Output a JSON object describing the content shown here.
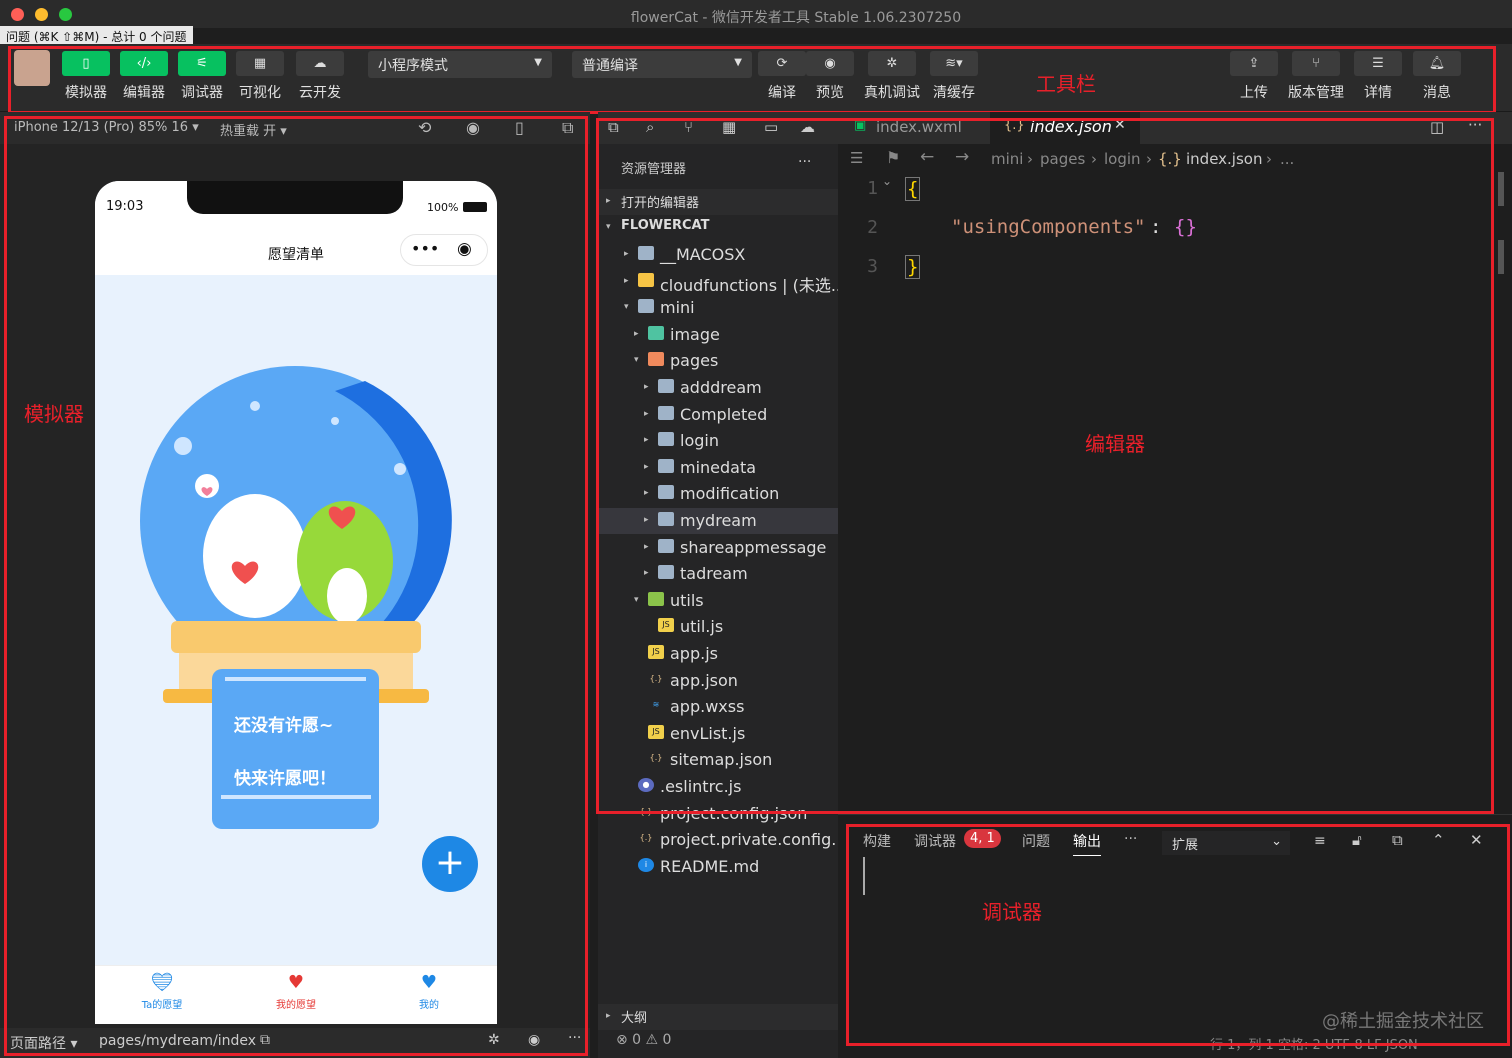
{
  "window": {
    "title": "flowerCat - 微信开发者工具 Stable 1.06.2307250",
    "issues": "问题 (⌘K ⇧⌘M) - 总计 0 个问题"
  },
  "toolbar": {
    "simulator": "模拟器",
    "editor": "编辑器",
    "debugger": "调试器",
    "visual": "可视化",
    "cloud": "云开发",
    "mode": "小程序模式",
    "compile_mode": "普通编译",
    "compile": "编译",
    "preview": "预览",
    "device_debug": "真机调试",
    "clear_cache": "清缓存",
    "upload": "上传",
    "version": "版本管理",
    "details": "详情",
    "messages": "消息"
  },
  "annotations": {
    "toolbar": "工具栏",
    "simulator": "模拟器",
    "editor": "编辑器",
    "debugger": "调试器"
  },
  "sim": {
    "device": "iPhone 12/13 (Pro) 85% 16 ▾",
    "hot_reload": "热重载 开 ▾",
    "time": "19:03",
    "battery": "100%",
    "page_title": "愿望清单",
    "empty1": "还没有许愿~",
    "empty2": "快来许愿吧！",
    "tabs": [
      "Ta的愿望",
      "我的愿望",
      "我的"
    ],
    "path_label": "页面路径 ▾",
    "path": "pages/mydream/index"
  },
  "explorer": {
    "title": "资源管理器",
    "open_editors": "打开的编辑器",
    "root": "FLOWERCAT",
    "outline": "大纲",
    "items": [
      {
        "name": "__MACOSX",
        "depth": 1,
        "type": "folder",
        "arrow": "▸"
      },
      {
        "name": "cloudfunctions | (未选...",
        "depth": 1,
        "type": "cloud",
        "arrow": "▸"
      },
      {
        "name": "mini",
        "depth": 1,
        "type": "folder",
        "arrow": "▾"
      },
      {
        "name": "image",
        "depth": 2,
        "type": "img",
        "arrow": "▸"
      },
      {
        "name": "pages",
        "depth": 2,
        "type": "pages",
        "arrow": "▾"
      },
      {
        "name": "adddream",
        "depth": 3,
        "type": "folder",
        "arrow": "▸"
      },
      {
        "name": "Completed",
        "depth": 3,
        "type": "folder",
        "arrow": "▸"
      },
      {
        "name": "login",
        "depth": 3,
        "type": "folder",
        "arrow": "▸"
      },
      {
        "name": "minedata",
        "depth": 3,
        "type": "folder",
        "arrow": "▸"
      },
      {
        "name": "modification",
        "depth": 3,
        "type": "folder",
        "arrow": "▸"
      },
      {
        "name": "mydream",
        "depth": 3,
        "type": "folder",
        "arrow": "▸"
      },
      {
        "name": "shareappmessage",
        "depth": 3,
        "type": "folder",
        "arrow": "▸"
      },
      {
        "name": "tadream",
        "depth": 3,
        "type": "folder",
        "arrow": "▸"
      },
      {
        "name": "utils",
        "depth": 2,
        "type": "utils",
        "arrow": "▾"
      },
      {
        "name": "util.js",
        "depth": 3,
        "type": "js",
        "arrow": ""
      },
      {
        "name": "app.js",
        "depth": 2,
        "type": "js",
        "arrow": ""
      },
      {
        "name": "app.json",
        "depth": 2,
        "type": "json",
        "arrow": ""
      },
      {
        "name": "app.wxss",
        "depth": 2,
        "type": "wxss",
        "arrow": ""
      },
      {
        "name": "envList.js",
        "depth": 2,
        "type": "js",
        "arrow": ""
      },
      {
        "name": "sitemap.json",
        "depth": 2,
        "type": "json",
        "arrow": ""
      },
      {
        "name": ".eslintrc.js",
        "depth": 1,
        "type": "eslint",
        "arrow": ""
      },
      {
        "name": "project.config.json",
        "depth": 1,
        "type": "json",
        "arrow": ""
      },
      {
        "name": "project.private.config...",
        "depth": 1,
        "type": "json",
        "arrow": ""
      },
      {
        "name": "README.md",
        "depth": 1,
        "type": "info",
        "arrow": ""
      }
    ],
    "errors": "⊗ 0 ⚠ 0"
  },
  "editor": {
    "tab1": "index.wxml",
    "tab2": "index.json",
    "crumbs": [
      "mini",
      "pages",
      "login",
      "index.json",
      "..."
    ],
    "lines": [
      "1",
      "2",
      "3"
    ],
    "code_open": "{",
    "code_key": "\"usingComponents\"",
    "code_colon": ":",
    "code_val": "{}",
    "code_close": "}"
  },
  "debug": {
    "tabs": [
      "构建",
      "调试器",
      "问题",
      "输出"
    ],
    "badge": "4, 1",
    "more": "···",
    "ext": "扩展",
    "status": "行 1，列 1   空格: 2   UTF-8   LF   JSON",
    "watermark": "@稀土掘金技术社区"
  },
  "colors": {
    "accent": "#07c160",
    "annotation": "#e8202a",
    "blue": "#1e88e5"
  }
}
